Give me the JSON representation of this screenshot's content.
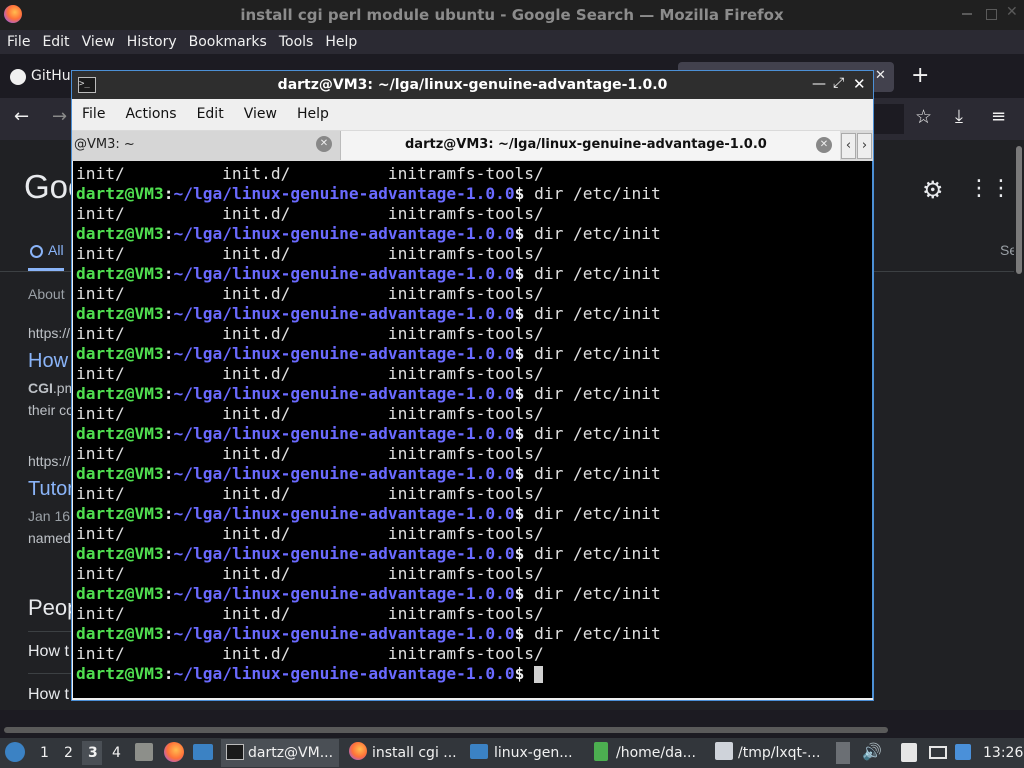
{
  "firefox": {
    "title": "install cgi perl module ubuntu - Google Search — Mozilla Firefox",
    "menu": [
      "File",
      "Edit",
      "View",
      "History",
      "Bookmarks",
      "Tools",
      "Help"
    ],
    "tab_left_label": "GitHu",
    "google": {
      "logo_partial": "Goo",
      "tab_all": "All",
      "tab_right_partial": "Se",
      "about": "About",
      "result1_url": "https://",
      "result1_title": "How",
      "result1_snippet_bold": "CGI",
      "result1_snippet": ".pm",
      "result1_snippet2": "their co",
      "result2_url": "https://",
      "result2_title": "Tutor",
      "result2_snippet": "Jan 16",
      "result2_snippet2": "named",
      "people_heading": "Peop",
      "paa1": "How t",
      "paa2": "How t"
    }
  },
  "terminal": {
    "title": "dartz@VM3: ~/lga/linux-genuine-advantage-1.0.0",
    "menu": [
      "File",
      "Actions",
      "Edit",
      "View",
      "Help"
    ],
    "tabs": [
      {
        "label": "@VM3: ~",
        "active": false
      },
      {
        "label": "dartz@VM3: ~/lga/linux-genuine-advantage-1.0.0",
        "active": true
      }
    ],
    "prompt_user": "dartz@VM3",
    "prompt_sep": ":",
    "prompt_path": "~/lga/linux-genuine-advantage-1.0.0",
    "prompt_suffix": "$ ",
    "command": "dir /etc/init",
    "output_line": "init/          init.d/          initramfs-tools/",
    "repeat_count": 12
  },
  "taskbar": {
    "desktops": [
      "1",
      "2",
      "3",
      "4"
    ],
    "active_desktop": "3",
    "items": [
      {
        "label": "dartz@VM..."
      },
      {
        "label": "install cgi ..."
      },
      {
        "label": "linux-gen..."
      },
      {
        "label": "/home/da..."
      },
      {
        "label": "/tmp/lxqt-..."
      }
    ],
    "clock": "13:26"
  }
}
